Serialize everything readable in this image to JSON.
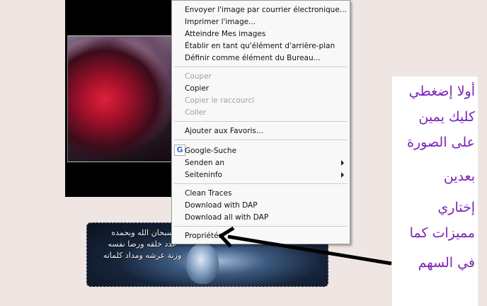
{
  "menu": {
    "items": [
      {
        "label": "Envoyer l'image par courrier électronique...",
        "enabled": true
      },
      {
        "label": "Imprimer l'image...",
        "enabled": true
      },
      {
        "label": "Atteindre Mes images",
        "enabled": true
      },
      {
        "label": "Établir en tant qu'élément d'arrière-plan",
        "enabled": true
      },
      {
        "label": "Définir comme élément du Bureau...",
        "enabled": true
      },
      {
        "label": "Couper",
        "enabled": false
      },
      {
        "label": "Copier",
        "enabled": true
      },
      {
        "label": "Copier le raccourci",
        "enabled": false
      },
      {
        "label": "Coller",
        "enabled": false
      },
      {
        "label": "Ajouter aux Favoris...",
        "enabled": true
      },
      {
        "label": "Google-Suche",
        "enabled": true,
        "icon": "google-icon"
      },
      {
        "label": "Senden an",
        "enabled": true,
        "submenu": true
      },
      {
        "label": "Seiteninfo",
        "enabled": true,
        "submenu": true
      },
      {
        "label": "Clean Traces",
        "enabled": true
      },
      {
        "label": "Download with DAP",
        "enabled": true
      },
      {
        "label": "Download all with DAP",
        "enabled": true
      },
      {
        "label": "Propriétés",
        "enabled": true
      }
    ],
    "google_letter": "G"
  },
  "banner": {
    "lines": [
      "سبحان الله وبحمده",
      "عدد خلقه ورضا نفسه",
      "وزنة عرشه ومداد كلماته"
    ]
  },
  "note": {
    "lines": [
      "أولا إضغطي",
      "كليك يمين",
      "على الصورة",
      "بعدين",
      "إختاري",
      "مميزات كما",
      "في السهم"
    ]
  },
  "colors": {
    "note_text": "#7a22b8",
    "menu_bg": "#f8f8f8",
    "page_bg": "#efe6e4"
  }
}
